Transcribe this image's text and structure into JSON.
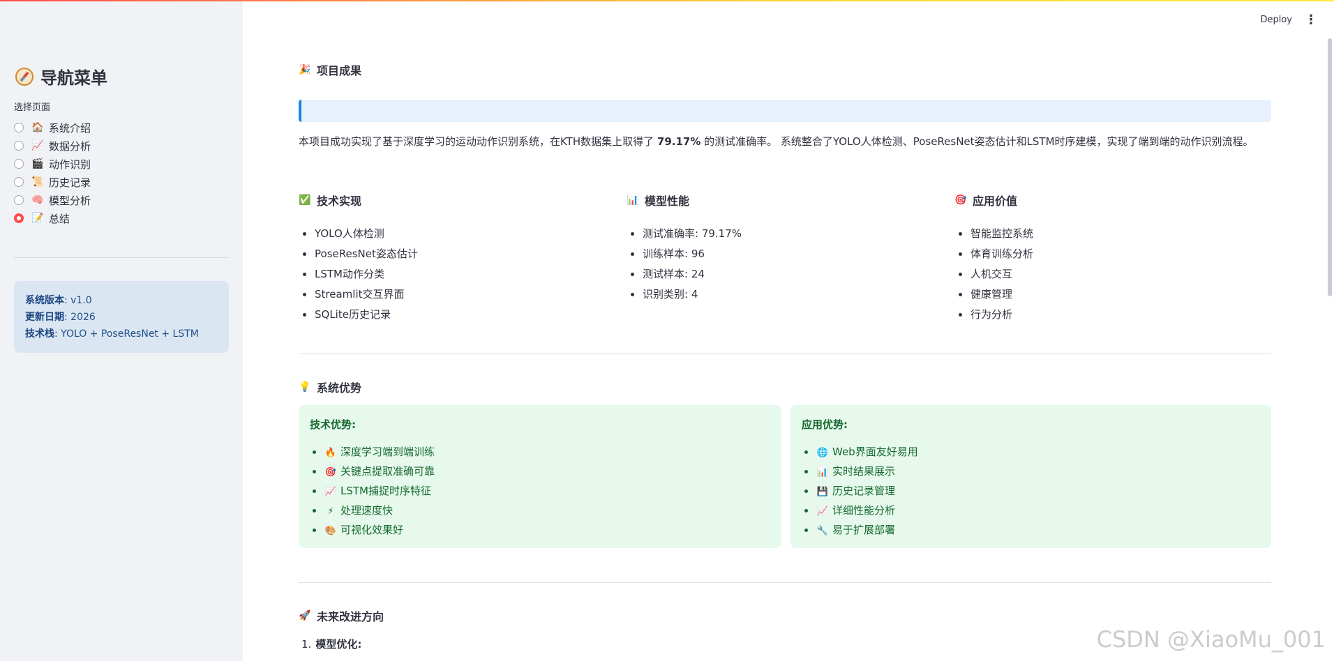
{
  "sidebar": {
    "title": "导航菜单",
    "title_icon": "compass-icon",
    "select_label": "选择页面",
    "options": [
      {
        "emoji": "🏠",
        "label": "系统介绍",
        "selected": false
      },
      {
        "emoji": "📈",
        "label": "数据分析",
        "selected": false
      },
      {
        "emoji": "🎬",
        "label": "动作识别",
        "selected": false
      },
      {
        "emoji": "📜",
        "label": "历史记录",
        "selected": false
      },
      {
        "emoji": "🧠",
        "label": "模型分析",
        "selected": false
      },
      {
        "emoji": "📝",
        "label": "总结",
        "selected": true
      }
    ],
    "info": {
      "version_label": "系统版本",
      "version_value": ": v1.0",
      "date_label": "更新日期",
      "date_value": ": 2026",
      "stack_label": "技术栈",
      "stack_value": ": YOLO + PoseResNet + LSTM"
    }
  },
  "header": {
    "deploy_label": "Deploy",
    "menu_icon": "⋮"
  },
  "main": {
    "results_title": "项目成果",
    "results_emoji": "🎉",
    "summary_pre": "本项目成功实现了基于深度学习的运动动作识别系统，在KTH数据集上取得了 ",
    "summary_accuracy": "79.17%",
    "summary_post": " 的测试准确率。 系统整合了YOLO人体检测、PoseResNet姿态估计和LSTM时序建模，实现了端到端的动作识别流程。",
    "columns": [
      {
        "emoji": "✅",
        "title": "技术实现",
        "items": [
          "YOLO人体检测",
          "PoseResNet姿态估计",
          "LSTM动作分类",
          "Streamlit交互界面",
          "SQLite历史记录"
        ]
      },
      {
        "emoji": "📊",
        "title": "模型性能",
        "items": [
          "测试准确率: 79.17%",
          "训练样本: 96",
          "测试样本: 24",
          "识别类别: 4"
        ]
      },
      {
        "emoji": "🎯",
        "title": "应用价值",
        "items": [
          "智能监控系统",
          "体育训练分析",
          "人机交互",
          "健康管理",
          "行为分析"
        ]
      }
    ],
    "advantages_title": "系统优势",
    "advantages_emoji": "💡",
    "tech_adv": {
      "title": "技术优势:",
      "items": [
        {
          "emoji": "🔥",
          "text": "深度学习端到端训练"
        },
        {
          "emoji": "🎯",
          "text": "关键点提取准确可靠"
        },
        {
          "emoji": "📈",
          "text": "LSTM捕捉时序特征"
        },
        {
          "emoji": "⚡",
          "text": "处理速度快"
        },
        {
          "emoji": "🎨",
          "text": "可视化效果好"
        }
      ]
    },
    "app_adv": {
      "title": "应用优势:",
      "items": [
        {
          "emoji": "🌐",
          "text": "Web界面友好易用"
        },
        {
          "emoji": "📊",
          "text": "实时结果展示"
        },
        {
          "emoji": "💾",
          "text": "历史记录管理"
        },
        {
          "emoji": "📈",
          "text": "详细性能分析"
        },
        {
          "emoji": "🔧",
          "text": "易于扩展部署"
        }
      ]
    },
    "future_title": "未来改进方向",
    "future_emoji": "🚀",
    "future_items": [
      {
        "num": "1.",
        "text": "模型优化:"
      }
    ]
  },
  "watermark": "CSDN @XiaoMu_001",
  "colors": {
    "accent": "#ff4b4b",
    "info_blue": "#1c83e1",
    "success_green": "#17692f",
    "sidebar_bg": "#f0f2f6"
  }
}
